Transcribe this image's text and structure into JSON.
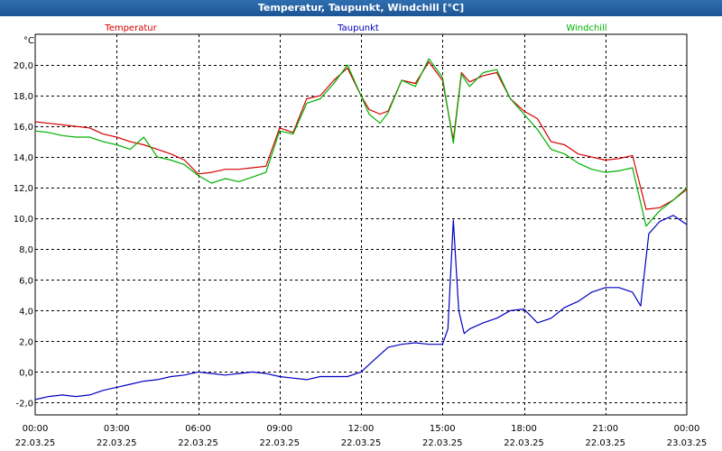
{
  "window": {
    "title": "Temperatur, Taupunkt, Windchill [°C]"
  },
  "chart_data": {
    "type": "line",
    "title": "Temperatur, Taupunkt, Windchill [°C]",
    "ylabel": "°C",
    "ylim": [
      -2.8,
      22.0
    ],
    "yticks": [
      -2.0,
      0.0,
      2.0,
      4.0,
      6.0,
      8.0,
      10.0,
      12.0,
      14.0,
      16.0,
      18.0,
      20.0
    ],
    "ytick_labels": [
      "-2,0",
      "0,0",
      "2,0",
      "4,0",
      "6,0",
      "8,0",
      "10,0",
      "12,0",
      "14,0",
      "16,0",
      "18,0",
      "20,0"
    ],
    "xlim": [
      0,
      24
    ],
    "xticks": [
      0,
      3,
      6,
      9,
      12,
      15,
      18,
      21,
      24
    ],
    "xtick_time": [
      "00:00",
      "03:00",
      "06:00",
      "09:00",
      "12:00",
      "15:00",
      "18:00",
      "21:00",
      "00:00"
    ],
    "xtick_date": [
      "22.03.25",
      "22.03.25",
      "22.03.25",
      "22.03.25",
      "22.03.25",
      "22.03.25",
      "22.03.25",
      "22.03.25",
      "23.03.25"
    ],
    "grid": true,
    "legend_position": "top",
    "series": [
      {
        "name": "Temperatur",
        "color": "#d40000",
        "x": [
          0,
          0.5,
          1,
          1.5,
          2,
          2.5,
          3,
          3.5,
          4,
          4.5,
          5,
          5.5,
          6,
          6.5,
          7,
          7.5,
          8,
          8.5,
          9,
          9.5,
          10,
          10.5,
          11,
          11.5,
          12,
          12.3,
          12.7,
          13,
          13.5,
          14,
          14.5,
          15,
          15.4,
          15.7,
          16,
          16.5,
          17,
          17.5,
          18,
          18.5,
          19,
          19.5,
          20,
          20.5,
          21,
          21.5,
          22,
          22.5,
          23,
          23.5,
          24
        ],
        "y": [
          16.3,
          16.2,
          16.1,
          16.0,
          15.9,
          15.5,
          15.3,
          15.0,
          14.8,
          14.5,
          14.2,
          13.8,
          12.9,
          13.0,
          13.2,
          13.2,
          13.3,
          13.4,
          15.9,
          15.6,
          17.8,
          18.0,
          19.0,
          19.8,
          18.0,
          17.1,
          16.8,
          17.0,
          19.0,
          18.8,
          20.2,
          19.0,
          15.1,
          19.5,
          18.9,
          19.3,
          19.5,
          17.8,
          17.0,
          16.5,
          15.0,
          14.8,
          14.2,
          14.0,
          13.8,
          13.9,
          14.1,
          10.6,
          10.7,
          11.2,
          11.9
        ]
      },
      {
        "name": "Taupunkt",
        "color": "#0000c0",
        "x": [
          0,
          0.5,
          1,
          1.5,
          2,
          2.5,
          3,
          3.5,
          4,
          4.5,
          5,
          5.5,
          6,
          6.5,
          7,
          7.5,
          8,
          8.5,
          9,
          9.5,
          10,
          10.5,
          11,
          11.5,
          12,
          12.5,
          13,
          13.5,
          14,
          14.5,
          15,
          15.2,
          15.4,
          15.6,
          15.8,
          16,
          16.5,
          17,
          17.5,
          18,
          18.5,
          19,
          19.5,
          20,
          20.5,
          21,
          21.5,
          22,
          22.3,
          22.6,
          23,
          23.5,
          24
        ],
        "y": [
          -1.8,
          -1.6,
          -1.5,
          -1.6,
          -1.5,
          -1.2,
          -1.0,
          -0.8,
          -0.6,
          -0.5,
          -0.3,
          -0.2,
          0.0,
          -0.1,
          -0.2,
          -0.1,
          0.0,
          -0.1,
          -0.3,
          -0.4,
          -0.5,
          -0.3,
          -0.3,
          -0.3,
          0.0,
          0.8,
          1.6,
          1.8,
          1.9,
          1.8,
          1.8,
          2.8,
          9.9,
          4.0,
          2.5,
          2.8,
          3.2,
          3.5,
          4.0,
          4.1,
          3.2,
          3.5,
          4.2,
          4.6,
          5.2,
          5.5,
          5.5,
          5.2,
          4.3,
          9.0,
          9.8,
          10.2,
          9.6
        ]
      },
      {
        "name": "Windchill",
        "color": "#00b000",
        "x": [
          0,
          0.5,
          1,
          1.5,
          2,
          2.5,
          3,
          3.5,
          4,
          4.5,
          5,
          5.5,
          6,
          6.5,
          7,
          7.5,
          8,
          8.5,
          9,
          9.5,
          10,
          10.5,
          11,
          11.5,
          12,
          12.3,
          12.7,
          13,
          13.5,
          14,
          14.5,
          15,
          15.4,
          15.7,
          16,
          16.5,
          17,
          17.5,
          18,
          18.5,
          19,
          19.5,
          20,
          20.5,
          21,
          21.5,
          22,
          22.5,
          23,
          23.5,
          24
        ],
        "y": [
          15.7,
          15.6,
          15.4,
          15.3,
          15.3,
          15.0,
          14.8,
          14.5,
          15.3,
          14.0,
          13.8,
          13.5,
          12.8,
          12.3,
          12.6,
          12.4,
          12.7,
          13.0,
          15.7,
          15.5,
          17.5,
          17.8,
          18.8,
          20.0,
          18.0,
          16.8,
          16.2,
          16.9,
          19.0,
          18.6,
          20.4,
          19.2,
          14.9,
          19.4,
          18.6,
          19.5,
          19.7,
          17.8,
          16.8,
          15.8,
          14.5,
          14.2,
          13.6,
          13.2,
          13.0,
          13.1,
          13.3,
          9.5,
          10.5,
          11.2,
          12.0
        ]
      }
    ]
  }
}
